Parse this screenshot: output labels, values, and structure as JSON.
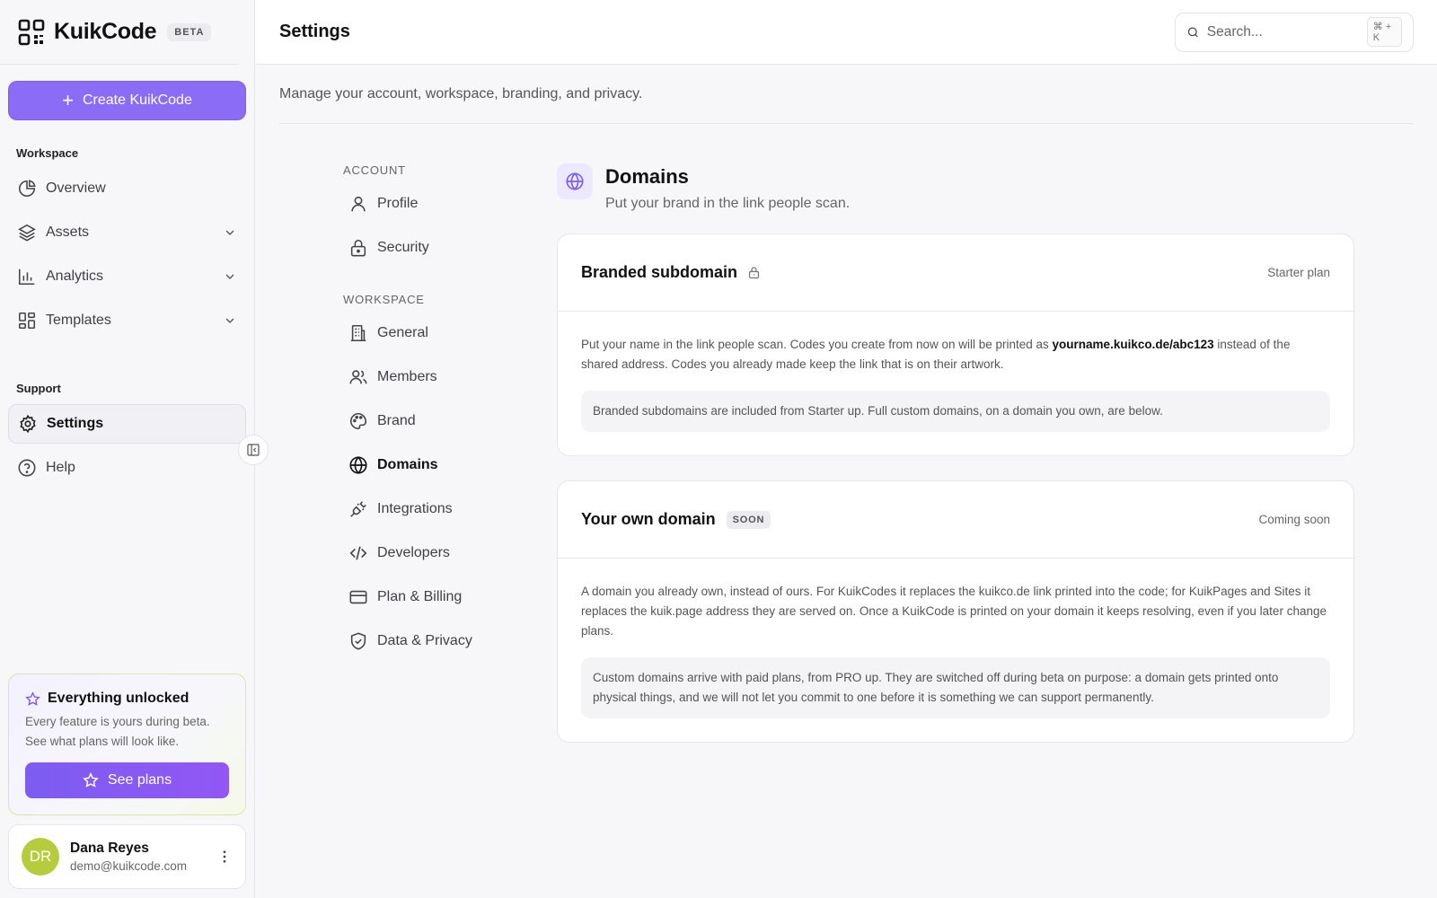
{
  "brand": {
    "name": "KuikCode",
    "badge": "BETA"
  },
  "sidebar": {
    "create_label": "Create KuikCode",
    "workspace_label": "Workspace",
    "workspace_items": [
      {
        "label": "Overview"
      },
      {
        "label": "Assets"
      },
      {
        "label": "Analytics"
      },
      {
        "label": "Templates"
      }
    ],
    "support_label": "Support",
    "support_items": [
      {
        "label": "Settings"
      },
      {
        "label": "Help"
      }
    ],
    "unlock": {
      "title": "Everything unlocked",
      "text": "Every feature is yours during beta. See what plans will look like.",
      "button": "See plans"
    },
    "user": {
      "initials": "DR",
      "name": "Dana Reyes",
      "email": "demo@kuikcode.com"
    }
  },
  "header": {
    "title": "Settings",
    "search_placeholder": "Search...",
    "search_shortcut": "⌘ + K"
  },
  "subtitle": "Manage your account, workspace, branding, and privacy.",
  "settings_nav": {
    "account_label": "ACCOUNT",
    "account_items": [
      {
        "label": "Profile"
      },
      {
        "label": "Security"
      }
    ],
    "workspace_label": "WORKSPACE",
    "workspace_items": [
      {
        "label": "General"
      },
      {
        "label": "Members"
      },
      {
        "label": "Brand"
      },
      {
        "label": "Domains"
      },
      {
        "label": "Integrations"
      },
      {
        "label": "Developers"
      },
      {
        "label": "Plan & Billing"
      },
      {
        "label": "Data & Privacy"
      }
    ]
  },
  "panel": {
    "title": "Domains",
    "subtitle": "Put your brand in the link people scan.",
    "cards": [
      {
        "title": "Branded subdomain",
        "meta": "Starter plan",
        "text_before": "Put your name in the link people scan. Codes you create from now on will be printed as ",
        "text_highlight": "yourname.kuikco.de/abc123",
        "text_after": " instead of the shared address. Codes you already made keep the link that is on their artwork.",
        "note": "Branded subdomains are included from Starter up. Full custom domains, on a domain you own, are below."
      },
      {
        "title": "Your own domain",
        "badge": "SOON",
        "meta": "Coming soon",
        "text": "A domain you already own, instead of ours. For KuikCodes it replaces the kuikco.de link printed into the code; for KuikPages and Sites it replaces the kuik.page address they are served on. Once a KuikCode is printed on your domain it keeps resolving, even if you later change plans.",
        "note": "Custom domains arrive with paid plans, from PRO up. They are switched off during beta on purpose: a domain gets printed onto physical things, and we will not let you commit to one before it is something we can support permanently."
      }
    ]
  },
  "colors": {
    "accent": "#8b6cf6",
    "avatar": "#b7cc3c"
  }
}
